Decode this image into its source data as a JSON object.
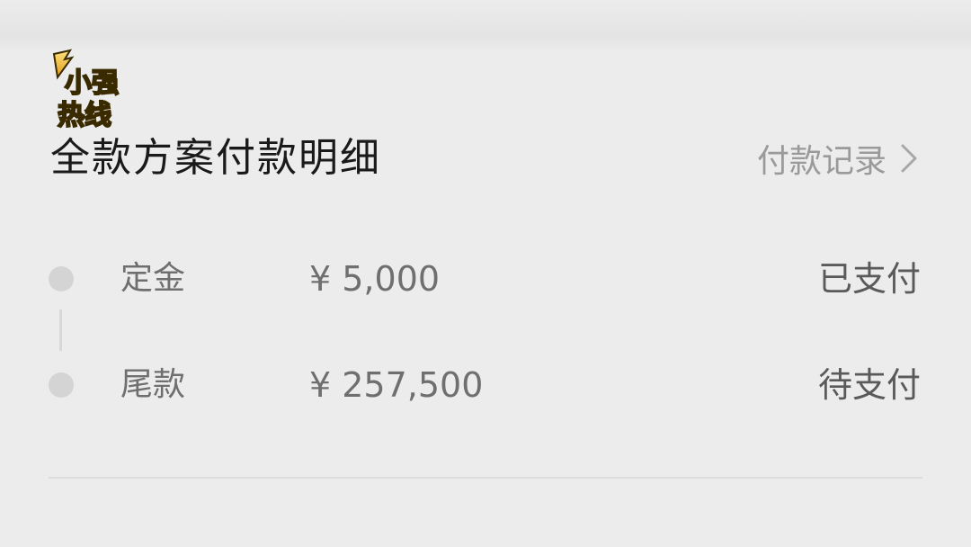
{
  "watermark": {
    "lines": [
      "小强",
      "热线"
    ]
  },
  "header": {
    "title": "全款方案付款明细",
    "records_link": "付款记录",
    "records_icon": "chevron-right-icon"
  },
  "payments": [
    {
      "label": "定金",
      "amount": "¥ 5,000",
      "status": "已支付"
    },
    {
      "label": "尾款",
      "amount": "¥ 257,500",
      "status": "待支付"
    }
  ],
  "colors": {
    "background": "#ececec",
    "title": "#1a1a1a",
    "muted": "#9a9a9a",
    "dot": "#d4d4d4",
    "watermark_gold": "#f2b632"
  }
}
